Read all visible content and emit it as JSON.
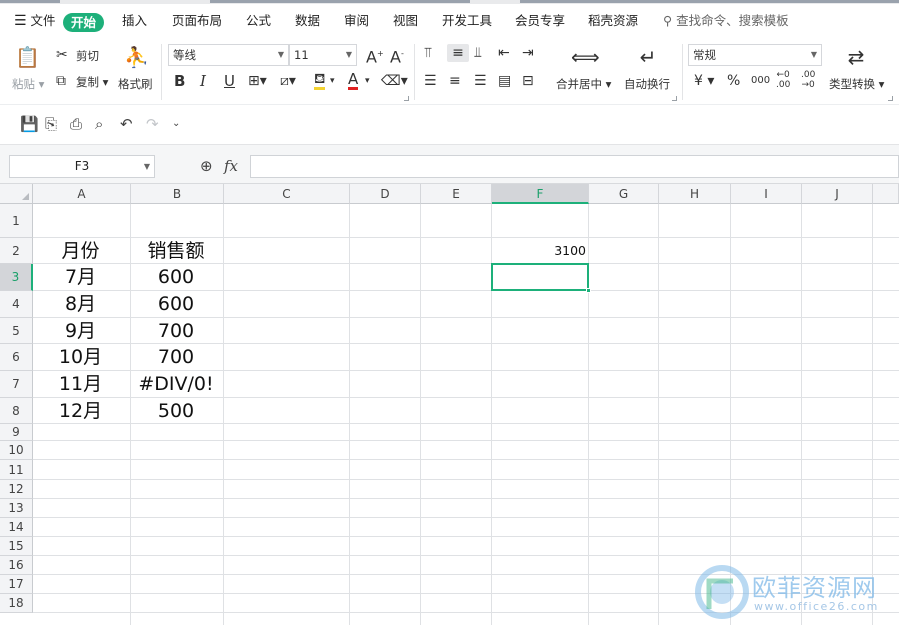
{
  "menubar": {
    "hamburger_label": "文件",
    "tabs": [
      "开始",
      "插入",
      "页面布局",
      "公式",
      "数据",
      "审阅",
      "视图",
      "开发工具",
      "会员专享",
      "稻壳资源"
    ],
    "active_tab": "开始",
    "search_placeholder": "查找命令、搜索模板"
  },
  "ribbon": {
    "clipboard": {
      "paste": "粘贴",
      "cut": "剪切",
      "copy": "复制",
      "format_painter": "格式刷"
    },
    "font": {
      "name": "等线",
      "size": "11",
      "bold": "B",
      "italic": "I",
      "underline": "U",
      "grow": "A",
      "shrink": "A",
      "font_color": "A"
    },
    "alignment": {
      "merge_center": "合并居中",
      "wrap_text": "自动换行"
    },
    "number": {
      "format": "常规",
      "currency": "¥",
      "percent": "%",
      "thousands": "000",
      "convert_type": "类型转换"
    }
  },
  "formula_bar": {
    "name_box": "F3",
    "fx": "fx",
    "formula": ""
  },
  "grid": {
    "columns": [
      "A",
      "B",
      "C",
      "D",
      "E",
      "F",
      "G",
      "H",
      "I",
      "J"
    ],
    "selected_column": "F",
    "rows": [
      "1",
      "2",
      "3",
      "4",
      "5",
      "6",
      "7",
      "8",
      "9",
      "10",
      "11",
      "12",
      "13",
      "14",
      "15",
      "16",
      "17",
      "18"
    ],
    "selected_row": "3",
    "cells": {
      "A2": "月份",
      "B2": "销售额",
      "A3": "7月",
      "B3": "600",
      "A4": "8月",
      "B4": "600",
      "A5": "9月",
      "B5": "700",
      "A6": "10月",
      "B6": "700",
      "A7": "11月",
      "B7": "#DIV/0!",
      "A8": "12月",
      "B8": "500",
      "F2": "3100"
    }
  },
  "watermark": {
    "name": "欧菲资源网",
    "url": "www.office26.com"
  },
  "colors": {
    "accent": "#1db07a",
    "watermark": "#7fb9e8"
  }
}
